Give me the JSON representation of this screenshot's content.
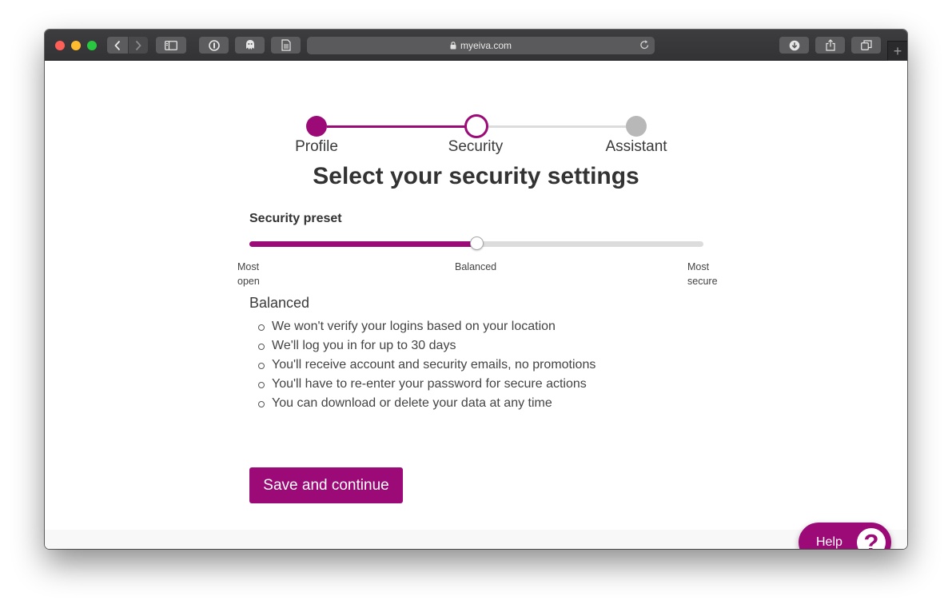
{
  "browser": {
    "url": "myeiva.com",
    "new_tab_symbol": "+"
  },
  "colors": {
    "accent": "#9b0a77",
    "inactive_dot": "#b8b8b8",
    "inactive_line": "#dcdcdc"
  },
  "stepper": {
    "steps": [
      {
        "label": "Profile",
        "state": "completed"
      },
      {
        "label": "Security",
        "state": "current"
      },
      {
        "label": "Assistant",
        "state": "upcoming"
      }
    ]
  },
  "page": {
    "title": "Select your security settings",
    "preset_label": "Security preset",
    "slider": {
      "value_fraction": 0.5,
      "ticks": [
        {
          "line1": "Most",
          "line2": "open"
        },
        {
          "line1": "Balanced",
          "line2": ""
        },
        {
          "line1": "Most",
          "line2": "secure"
        }
      ]
    },
    "level_title": "Balanced",
    "bullets": [
      "We won't verify your logins based on your location",
      "We'll log you in for up to 30 days",
      "You'll receive account and security emails, no promotions",
      "You'll have to re-enter your password for secure actions",
      "You can download or delete your data at any time"
    ],
    "save_label": "Save and continue",
    "help_label": "Help",
    "help_icon_glyph": "?"
  }
}
